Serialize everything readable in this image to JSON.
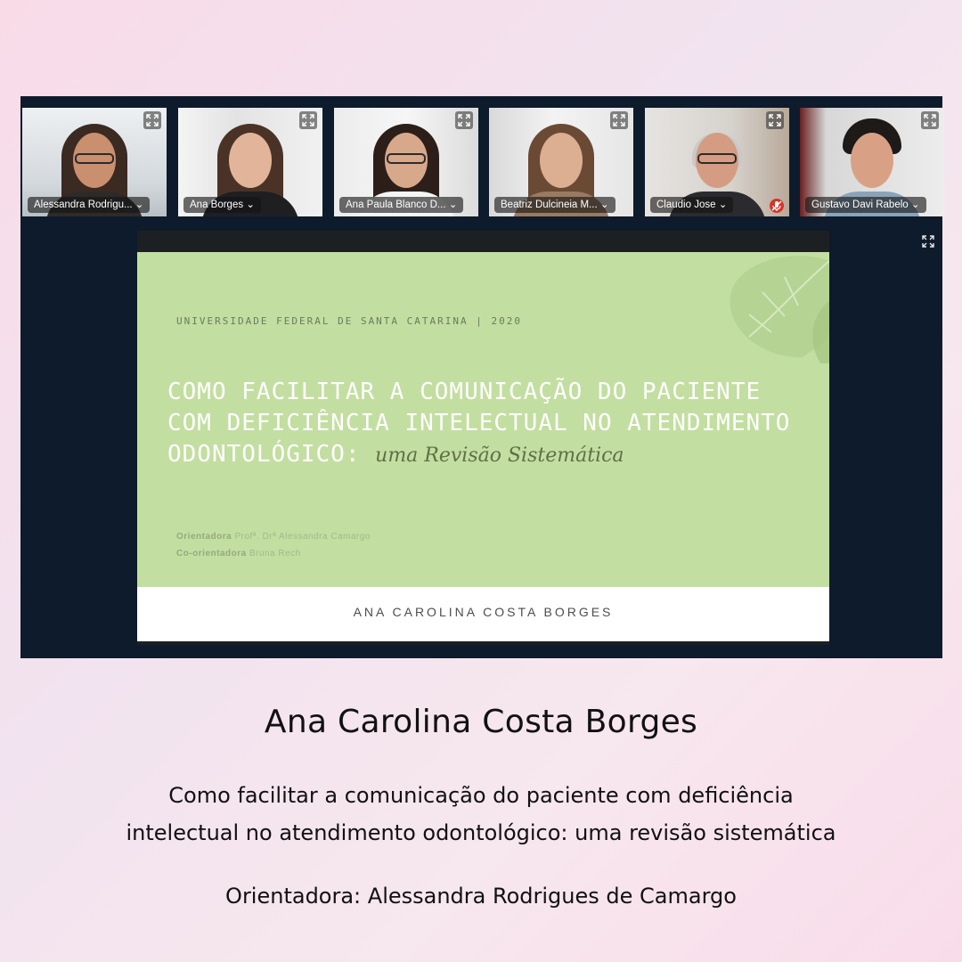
{
  "meeting": {
    "participants": [
      {
        "name": "Alessandra Rodrigu...",
        "muted": false
      },
      {
        "name": "Ana Borges",
        "muted": false
      },
      {
        "name": "Ana Paula Blanco D...",
        "muted": false
      },
      {
        "name": "Beatriz Dulcineia M...",
        "muted": false
      },
      {
        "name": "Claudio Jose",
        "muted": true
      },
      {
        "name": "Gustavo Davi Rabelo",
        "muted": false
      }
    ],
    "icons": {
      "tile_expand": "expand-arrows-icon",
      "menu": "chevron-down-icon",
      "muted": "microphone-muted-icon",
      "main_expand": "expand-arrows-icon"
    }
  },
  "slide": {
    "university": "UNIVERSIDADE FEDERAL DE SANTA CATARINA | 2020",
    "title_lines": [
      "COMO FACILITAR A COMUNICAÇÃO DO PACIENTE",
      "COM DEFICIÊNCIA INTELECTUAL NO ATENDIMENTO",
      "ODONTOLÓGICO:"
    ],
    "title_script": "uma Revisão Sistemática",
    "advisor_label": "Orientadora",
    "advisor_name": "Profª. Drª Alessandra Camargo",
    "coadvisor_label": "Co-orientadora",
    "coadvisor_name": "Bruna Rech",
    "author": "ANA CAROLINA COSTA BORGES",
    "colors": {
      "green": "#c3dea1",
      "footer": "#ffffff"
    }
  },
  "caption": {
    "name": "Ana Carolina Costa Borges",
    "title_line1": "Como facilitar a comunicação do paciente com deficiência",
    "title_line2": "intelectual no atendimento odontológico: uma revisão sistemática",
    "advisor": "Orientadora: Alessandra Rodrigues de Camargo"
  }
}
